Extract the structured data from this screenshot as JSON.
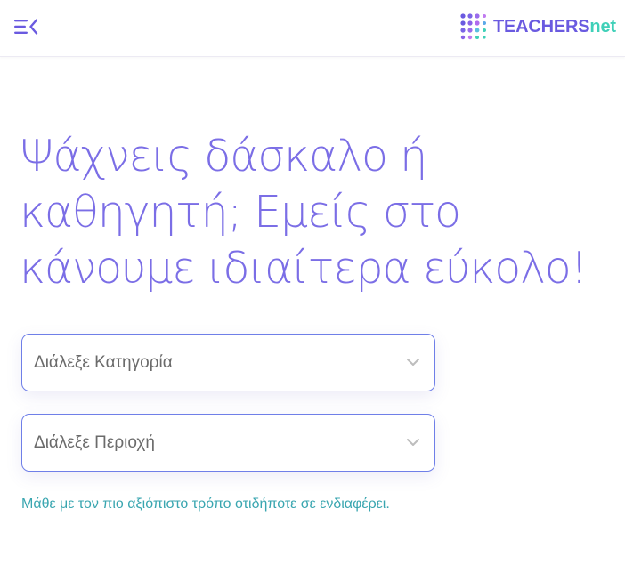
{
  "header": {
    "logo": {
      "brand": "TEACHERS",
      "suffix": "net"
    }
  },
  "hero": {
    "headline_lines": [
      "Ψάχνεις δάσκαλο ή",
      "καθηγητή; Εμείς στο",
      "κάνουμε ιδιαίτερα εύκολο!"
    ]
  },
  "filters": {
    "category": {
      "placeholder": "Διάλεξε Κατηγορία"
    },
    "region": {
      "placeholder": "Διάλεξε Περιοχή"
    }
  },
  "tagline": "Μάθε με τον πιο αξιόπιστο τρόπο οτιδήποτε σε ενδιαφέρει.",
  "colors": {
    "primary": "#7b6ee6",
    "accent": "#3fd0b8",
    "select_border": "#6f7fe8",
    "tagline": "#3aa6b0"
  },
  "icons": {
    "menu": "menu-collapse-icon",
    "logo": "dot-grid-logo-icon",
    "dropdown": "chevron-down-icon"
  }
}
